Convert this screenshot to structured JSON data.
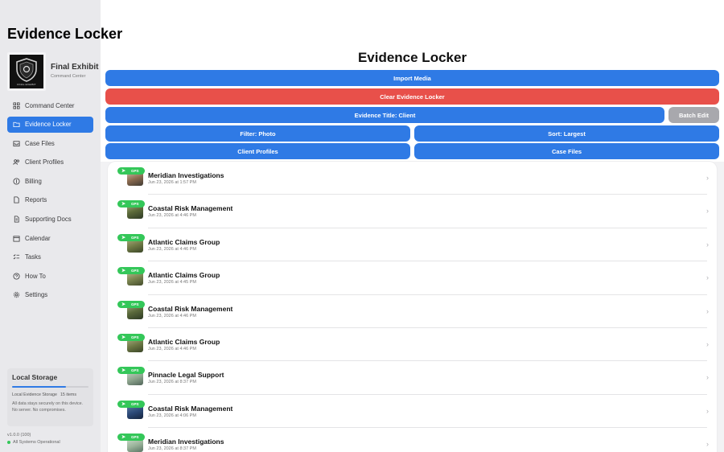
{
  "sidebar": {
    "title": "Evidence Locker",
    "profile": {
      "name": "Final Exhibit",
      "subtitle": "Command Center",
      "logo_text": "FINAL EXHIBIT"
    },
    "items": [
      {
        "label": "Command Center",
        "icon": "grid-icon"
      },
      {
        "label": "Evidence Locker",
        "icon": "folder-icon",
        "active": true
      },
      {
        "label": "Case Files",
        "icon": "tray-icon"
      },
      {
        "label": "Client Profiles",
        "icon": "people-icon"
      },
      {
        "label": "Billing",
        "icon": "dollar-icon"
      },
      {
        "label": "Reports",
        "icon": "doc-icon"
      },
      {
        "label": "Supporting Docs",
        "icon": "docs-icon"
      },
      {
        "label": "Calendar",
        "icon": "calendar-icon"
      },
      {
        "label": "Tasks",
        "icon": "checklist-icon"
      },
      {
        "label": "How To",
        "icon": "help-icon"
      },
      {
        "label": "Settings",
        "icon": "gear-icon"
      }
    ],
    "storage": {
      "title": "Local Storage",
      "label": "Local Evidence Storage",
      "count": "15 items",
      "fill_percent": 70,
      "desc": "All data stays securely on this device. No server. No compromises."
    },
    "version": "v1.0.0 (100)",
    "status": "All Systems Operational"
  },
  "main": {
    "title": "Evidence Locker",
    "buttons": {
      "import": "Import Media",
      "clear": "Clear Evidence Locker",
      "evidence_title": "Evidence Title: Client",
      "batch_edit": "Batch Edit",
      "filter": "Filter: Photo",
      "sort": "Sort: Largest",
      "client_profiles": "Client Profiles",
      "case_files": "Case Files"
    },
    "badge_label": "GPS",
    "rows": [
      {
        "title": "Meridian Investigations",
        "date": "Jun 23, 2026 at 1:57 PM"
      },
      {
        "title": "Coastal Risk Management",
        "date": "Jun 23, 2026 at 4:46 PM"
      },
      {
        "title": "Atlantic Claims Group",
        "date": "Jun 23, 2026 at 4:46 PM"
      },
      {
        "title": "Atlantic Claims Group",
        "date": "Jun 23, 2026 at 4:45 PM"
      },
      {
        "title": "Coastal Risk Management",
        "date": "Jun 23, 2026 at 4:46 PM"
      },
      {
        "title": "Atlantic Claims Group",
        "date": "Jun 23, 2026 at 4:46 PM"
      },
      {
        "title": "Pinnacle Legal Support",
        "date": "Jun 23, 2026 at 8:37 PM"
      },
      {
        "title": "Coastal Risk Management",
        "date": "Jun 23, 2026 at 4:06 PM"
      },
      {
        "title": "Meridian Investigations",
        "date": "Jun 23, 2026 at 8:37 PM"
      }
    ]
  },
  "colors": {
    "accent": "#2f7ae5",
    "danger": "#e8504a",
    "gps": "#34c759",
    "neutral_button": "#a8a8ad"
  }
}
